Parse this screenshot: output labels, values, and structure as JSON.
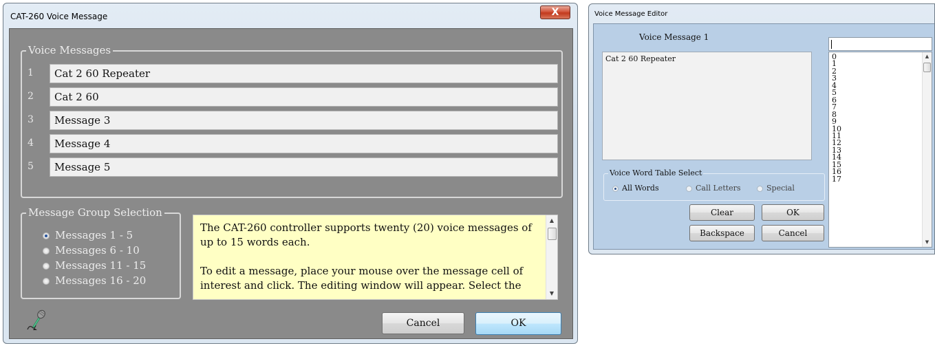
{
  "voice_message_window": {
    "title": "CAT-260 Voice Message",
    "close_label": "X",
    "voice_messages_group": "Voice Messages",
    "messages": [
      {
        "num": "1",
        "text": "Cat 2 60 Repeater"
      },
      {
        "num": "2",
        "text": "Cat 2 60"
      },
      {
        "num": "3",
        "text": "Message 3"
      },
      {
        "num": "4",
        "text": "Message 4"
      },
      {
        "num": "5",
        "text": "Message 5"
      }
    ],
    "group_selection_label": "Message Group Selection",
    "groups": [
      "Messages 1 - 5",
      "Messages 6 - 10",
      "Messages 11 - 15",
      "Messages 16 - 20"
    ],
    "selected_group": "Messages 1 - 5",
    "info_paragraph_1": "The CAT-260 controller supports twenty (20) voice messages of up to 15 words each.",
    "info_paragraph_2": "To edit a message, place your mouse over the message cell of interest and click.  The editing window will appear.  Select the",
    "cancel_label": "Cancel",
    "ok_label": "OK",
    "icon": "microphone-icon"
  },
  "editor_window": {
    "title": "Voice Message Editor",
    "message_label": "Voice  Message 1",
    "message_text": "Cat 2 60 Repeater",
    "word_input_value": "",
    "word_list": [
      "0",
      "1",
      "2",
      "3",
      "4",
      "5",
      "6",
      "7",
      "8",
      "9",
      "10",
      "11",
      "12",
      "13",
      "14",
      "15",
      "16",
      "17"
    ],
    "table_select_label": "Voice Word Table Select",
    "table_options": [
      "All Words",
      "Call Letters",
      "Special"
    ],
    "selected_table": "All Words",
    "clear_label": "Clear",
    "ok_label": "OK",
    "backspace_label": "Backspace",
    "cancel_label": "Cancel"
  },
  "colors": {
    "window_frame": "#dbe6f1",
    "client_gray": "#8a8a8a",
    "info_background": "#ffffc4",
    "editor_background": "#b9cfe6",
    "close_button": "#c2391d"
  }
}
